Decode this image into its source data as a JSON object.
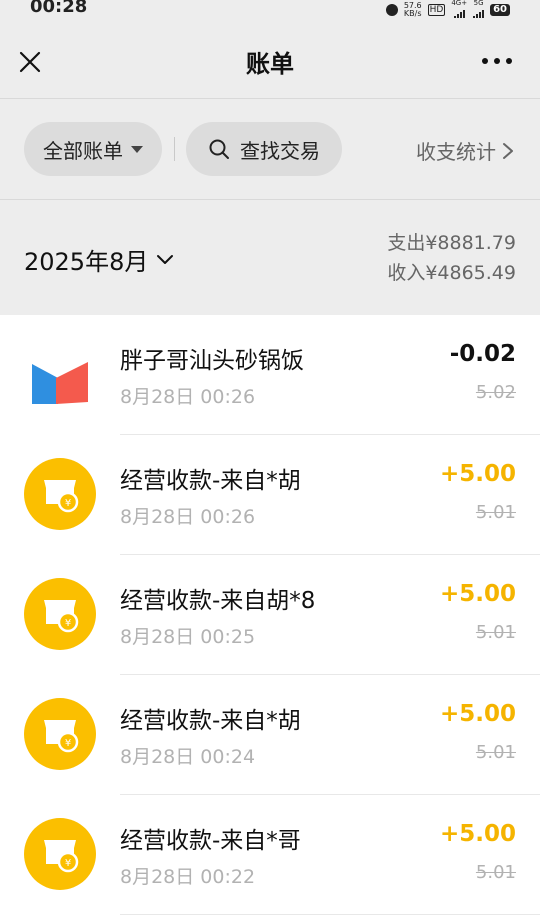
{
  "status_bar": {
    "time": "00:28",
    "net_speed_top": "57.6",
    "net_speed_bottom": "KB/s",
    "hd_label": "HD",
    "signal1_label": "4G+",
    "signal2_label": "5G",
    "battery": "60"
  },
  "nav": {
    "title": "账单"
  },
  "filters": {
    "all_bills": "全部账单",
    "search": "查找交易",
    "stats": "收支统计"
  },
  "month": {
    "label": "2025年8月",
    "expense": "支出¥8881.79",
    "income": "收入¥4865.49"
  },
  "transactions": [
    {
      "name": "胖子哥汕头砂锅饭",
      "time": "8月28日 00:26",
      "amount": "-0.02",
      "original": "5.02",
      "type": "expense",
      "icon": "merchant-logo-icon"
    },
    {
      "name": "经营收款-来自*胡",
      "time": "8月28日 00:26",
      "amount": "+5.00",
      "original": "5.01",
      "type": "income",
      "icon": "store-coin-icon"
    },
    {
      "name": "经营收款-来自胡*8",
      "time": "8月28日 00:25",
      "amount": "+5.00",
      "original": "5.01",
      "type": "income",
      "icon": "store-coin-icon"
    },
    {
      "name": "经营收款-来自*胡",
      "time": "8月28日 00:24",
      "amount": "+5.00",
      "original": "5.01",
      "type": "income",
      "icon": "store-coin-icon"
    },
    {
      "name": "经营收款-来自*哥",
      "time": "8月28日 00:22",
      "amount": "+5.00",
      "original": "5.01",
      "type": "income",
      "icon": "store-coin-icon"
    }
  ],
  "colors": {
    "background": "#ededed",
    "income_amount": "#f5b400",
    "coin_icon": "#fbbf00",
    "logo_blue": "#2f8fe0",
    "logo_red": "#f45a4d"
  }
}
